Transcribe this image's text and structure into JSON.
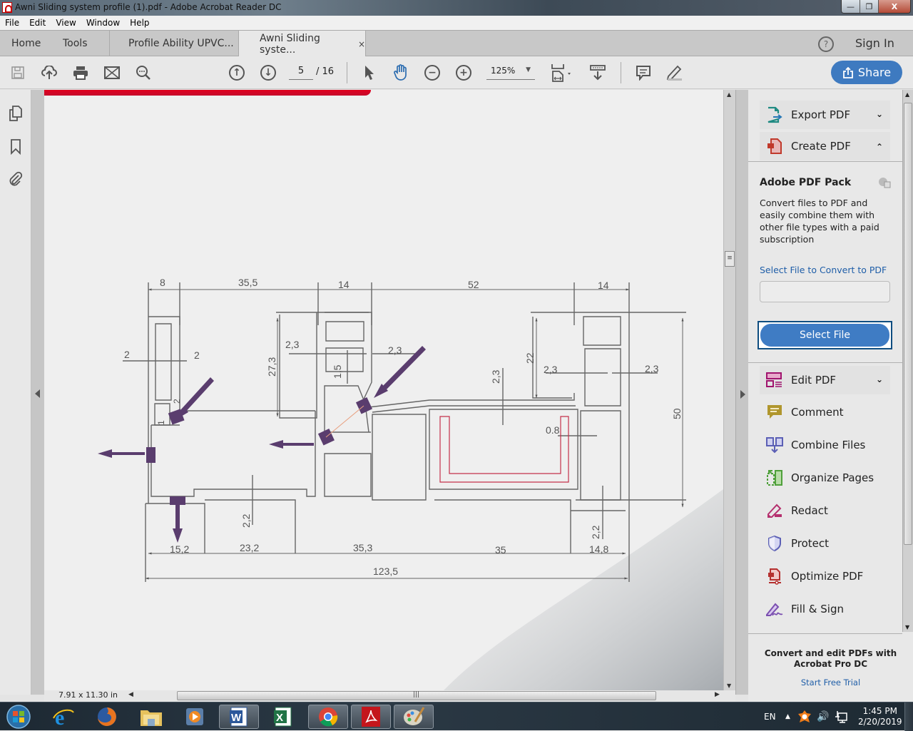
{
  "window": {
    "title": "Awni Sliding system profile (1).pdf - Adobe Acrobat Reader DC",
    "buttons": {
      "minimize": "—",
      "restore": "❐",
      "close": "X"
    }
  },
  "menu": [
    "File",
    "Edit",
    "View",
    "Window",
    "Help"
  ],
  "tabs": {
    "home": "Home",
    "tools": "Tools",
    "doc1": "Profile Ability UPVC...",
    "doc2": "Awni Sliding syste...",
    "close": "×",
    "help": "?",
    "sign_in": "Sign In"
  },
  "toolbar": {
    "icons": [
      "save-icon",
      "upload-cloud-icon",
      "print-icon",
      "email-icon",
      "find-icon",
      "prev-page-icon",
      "next-page-icon",
      "select-cursor-icon",
      "hand-icon",
      "zoom-out-icon",
      "zoom-in-icon",
      "fit-page-icon",
      "scroll-mode-icon",
      "comment-icon",
      "highlight-pen-icon"
    ],
    "current_page": "5",
    "total_pages": "/ 16",
    "zoom": "125%",
    "share": "Share"
  },
  "left_rail": [
    "pages-icon",
    "bookmark-icon",
    "attachment-icon"
  ],
  "document": {
    "drawing_dimensions": {
      "top": [
        "8",
        "35,5",
        "14",
        "52",
        "14"
      ],
      "wall_thickness": [
        "2",
        "2",
        "2,3",
        "2,3",
        "2,3",
        "2,3",
        "2,3",
        "0.8",
        "2,2",
        "2,2",
        "1",
        "2",
        "1,5"
      ],
      "heights": [
        "27,3",
        "22",
        "50"
      ],
      "bottom": [
        "15,2",
        "23,2",
        "35,3",
        "35",
        "14,8"
      ],
      "overall": "123,5"
    },
    "status_size": "7.91 x 11.30 in"
  },
  "right_panel": {
    "items_top": [
      {
        "label": "Export PDF",
        "icon": "export-pdf-icon",
        "chevron": "⌄",
        "color": "#1f8a82"
      },
      {
        "label": "Create PDF",
        "icon": "create-pdf-icon",
        "chevron": "⌃",
        "color": "#c0392b"
      }
    ],
    "pack": {
      "title": "Adobe PDF Pack",
      "description": "Convert files to PDF and easily combine them with other file types with a paid subscription",
      "select_label": "Select File to Convert to PDF",
      "select_value": "",
      "button": "Select File"
    },
    "items": [
      {
        "label": "Edit PDF",
        "icon": "edit-pdf-icon",
        "color": "#a0146e"
      },
      {
        "label": "Comment",
        "icon": "comment-icon",
        "color": "#b0962d"
      },
      {
        "label": "Combine Files",
        "icon": "combine-files-icon",
        "color": "#5b5fb5"
      },
      {
        "label": "Organize Pages",
        "icon": "organize-pages-icon",
        "color": "#4ea03a"
      },
      {
        "label": "Redact",
        "icon": "redact-icon",
        "color": "#b5306e"
      },
      {
        "label": "Protect",
        "icon": "protect-icon",
        "color": "#5b5fb5"
      },
      {
        "label": "Optimize PDF",
        "icon": "optimize-pdf-icon",
        "color": "#b5302f"
      },
      {
        "label": "Fill & Sign",
        "icon": "fill-sign-icon",
        "color": "#7b4fb0"
      }
    ],
    "promo": "Convert and edit PDFs with Acrobat Pro DC",
    "trial": "Start Free Trial"
  },
  "taskbar": {
    "apps": [
      "start-button",
      "internet-explorer-icon",
      "firefox-icon",
      "file-explorer-icon",
      "media-player-icon",
      "word-icon",
      "excel-icon",
      "chrome-icon",
      "acrobat-icon",
      "paint-icon"
    ],
    "language": "EN",
    "time": "1:45 PM",
    "date": "2/20/2019"
  }
}
